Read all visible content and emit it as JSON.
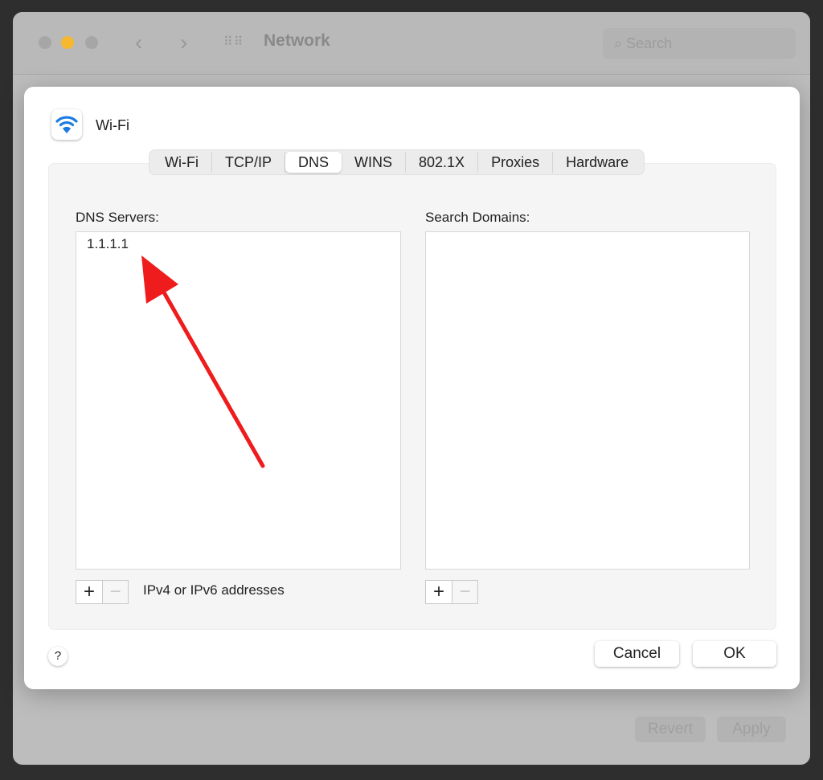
{
  "window": {
    "title": "Network",
    "search_placeholder": "Search",
    "revert_label": "Revert",
    "apply_label": "Apply"
  },
  "sheet": {
    "interface": "Wi-Fi",
    "tabs": [
      "Wi-Fi",
      "TCP/IP",
      "DNS",
      "WINS",
      "802.1X",
      "Proxies",
      "Hardware"
    ],
    "active_tab": "DNS",
    "dns_servers": {
      "label": "DNS Servers:",
      "items": [
        "1.1.1.1"
      ],
      "hint": "IPv4 or IPv6 addresses"
    },
    "search_domains": {
      "label": "Search Domains:",
      "items": []
    },
    "add_label": "+",
    "remove_label": "−",
    "help_label": "?",
    "cancel_label": "Cancel",
    "ok_label": "OK"
  },
  "colors": {
    "annotation_arrow": "#ee1c1c",
    "wifi_icon": "#1a7be0",
    "minimize_light": "#f5b82e"
  }
}
